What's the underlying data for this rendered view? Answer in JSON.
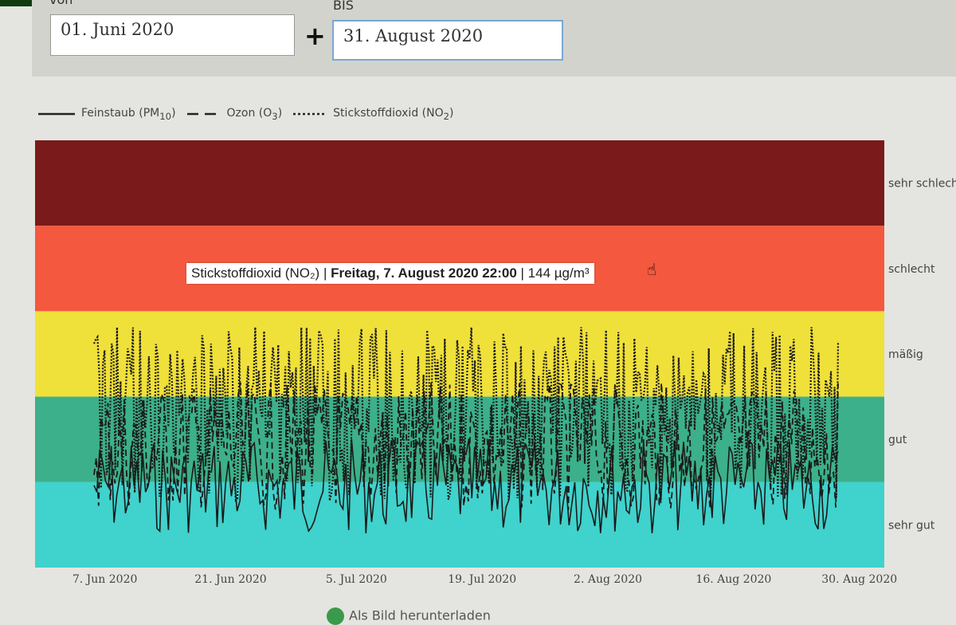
{
  "form": {
    "from_label": "von",
    "from_value": "01. Juni 2020",
    "plus_symbol": "+",
    "to_label": "BIS",
    "to_value": "31. August 2020"
  },
  "legend": [
    {
      "name_pre": "Feinstaub (PM",
      "sub": "10",
      "post": ")",
      "dash": "none"
    },
    {
      "name_pre": "Ozon (O",
      "sub": "3",
      "post": ")",
      "dash": "long"
    },
    {
      "name_pre": "Stickstoffdioxid (NO",
      "sub": "2",
      "post": ")",
      "dash": "dot"
    }
  ],
  "tooltip": {
    "series": "Stickstoffdioxid (NO₂)",
    "separator1": " | ",
    "datetime": "Freitag, 7. August 2020 22:00",
    "separator2": " | ",
    "value": "144 µg/m³"
  },
  "download_label": "Als Bild herunterladen",
  "chart_data": {
    "type": "line",
    "title": "",
    "x_start": "2020-06-01",
    "x_end": "2020-08-31",
    "xticks": [
      "7. Jun 2020",
      "21. Jun 2020",
      "5. Jul 2020",
      "19. Jul 2020",
      "2. Aug 2020",
      "16. Aug 2020",
      "30. Aug 2020"
    ],
    "bands": [
      {
        "label": "sehr schlecht",
        "color": "#7a1a1a"
      },
      {
        "label": "schlecht",
        "color": "#f4583f"
      },
      {
        "label": "mäßig",
        "color": "#f0e03a"
      },
      {
        "label": "gut",
        "color": "#3cb08a"
      },
      {
        "label": "sehr gut",
        "color": "#40d2cc"
      }
    ],
    "series": [
      {
        "name": "Feinstaub (PM10)",
        "dash": "solid"
      },
      {
        "name": "Ozon (O3)",
        "dash": "dashed"
      },
      {
        "name": "Stickstoffdioxid (NO2)",
        "dash": "dotted"
      }
    ],
    "highlight_point": {
      "series": "Stickstoffdioxid (NO2)",
      "datetime": "2020-08-07 22:00",
      "value": 144,
      "unit": "µg/m³"
    }
  }
}
